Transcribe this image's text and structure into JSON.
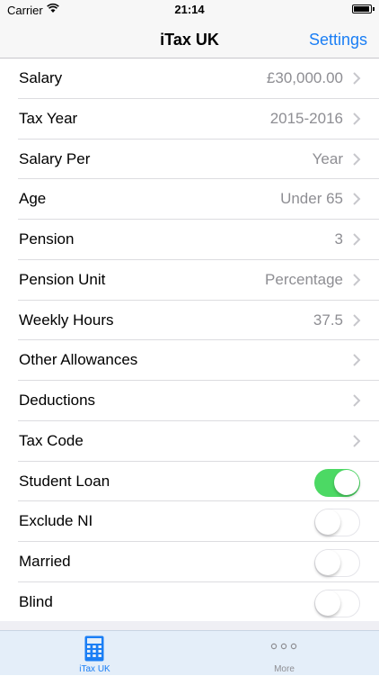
{
  "status_bar": {
    "carrier": "Carrier",
    "time": "21:14"
  },
  "nav": {
    "title": "iTax UK",
    "settings_label": "Settings"
  },
  "rows": [
    {
      "label": "Salary",
      "value": "£30,000.00"
    },
    {
      "label": "Tax Year",
      "value": "2015-2016"
    },
    {
      "label": "Salary Per",
      "value": "Year"
    },
    {
      "label": "Age",
      "value": "Under 65"
    },
    {
      "label": "Pension",
      "value": "3"
    },
    {
      "label": "Pension Unit",
      "value": "Percentage"
    },
    {
      "label": "Weekly Hours",
      "value": "37.5"
    },
    {
      "label": "Other Allowances",
      "value": ""
    },
    {
      "label": "Deductions",
      "value": ""
    },
    {
      "label": "Tax Code",
      "value": ""
    }
  ],
  "toggles": [
    {
      "label": "Student Loan",
      "on": true
    },
    {
      "label": "Exclude NI",
      "on": false
    },
    {
      "label": "Married",
      "on": false
    },
    {
      "label": "Blind",
      "on": false
    }
  ],
  "tabs": [
    {
      "label": "iTax UK",
      "icon": "calculator-icon",
      "active": true
    },
    {
      "label": "More",
      "icon": "more-icon",
      "active": false
    }
  ],
  "colors": {
    "accent": "#1a7ef5",
    "toggle_on": "#4cd964",
    "value_gray": "#8e8e93"
  }
}
